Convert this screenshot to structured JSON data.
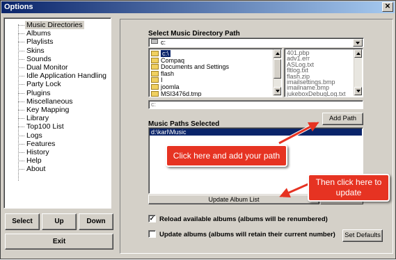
{
  "window": {
    "title": "Options",
    "close_glyph": "✕"
  },
  "tree": {
    "items": [
      "Music Directories",
      "Albums",
      "Playlists",
      "Skins",
      "Sounds",
      "Dual Monitor",
      "Idle Application Handling",
      "Party Lock",
      "Plugins",
      "Miscellaneous",
      "Key Mapping",
      "Library",
      "Top100 List",
      "Logs",
      "Features",
      "History",
      "Help",
      "About"
    ],
    "selected_index": 0
  },
  "left_buttons": {
    "select": "Select",
    "up": "Up",
    "down": "Down",
    "exit": "Exit"
  },
  "directory": {
    "title": "Select Music Directory Path",
    "drive_value": "c:",
    "folders": [
      {
        "name": "c:\\",
        "selected": true
      },
      {
        "name": "Compaq",
        "selected": false
      },
      {
        "name": "Documents and Settings",
        "selected": false
      },
      {
        "name": "flash",
        "selected": false
      },
      {
        "name": "I",
        "selected": false
      },
      {
        "name": "joomla",
        "selected": false
      },
      {
        "name": "MSI3476d.tmp",
        "selected": false
      }
    ],
    "files": [
      "401.pbp",
      "adv1.err",
      "ASLog.txt",
      "fltlog.txt",
      "flash.zip",
      "imailsettings.bmp",
      "imailname.bmp",
      "jukeboxDebugLog.txt"
    ],
    "path_value": "c:",
    "add_path": "Add Path"
  },
  "paths": {
    "title": "Music Paths Selected",
    "items": [
      "d:\\karl\\Music"
    ],
    "update_album_list": "Update Album List"
  },
  "options": {
    "reload": {
      "label": "Reload available albums (albums will be renumbered)",
      "checked": true,
      "mark": "✓"
    },
    "update": {
      "label": "Update albums (albums will retain their current number)",
      "checked": false,
      "mark": ""
    },
    "set_defaults": "Set Defaults"
  },
  "annotations": {
    "callout1": "Click here and add your path",
    "callout2": "Then click here to update"
  },
  "colors": {
    "callout": "#e63322",
    "titlebar_start": "#0a246a",
    "selection": "#0a246a"
  }
}
